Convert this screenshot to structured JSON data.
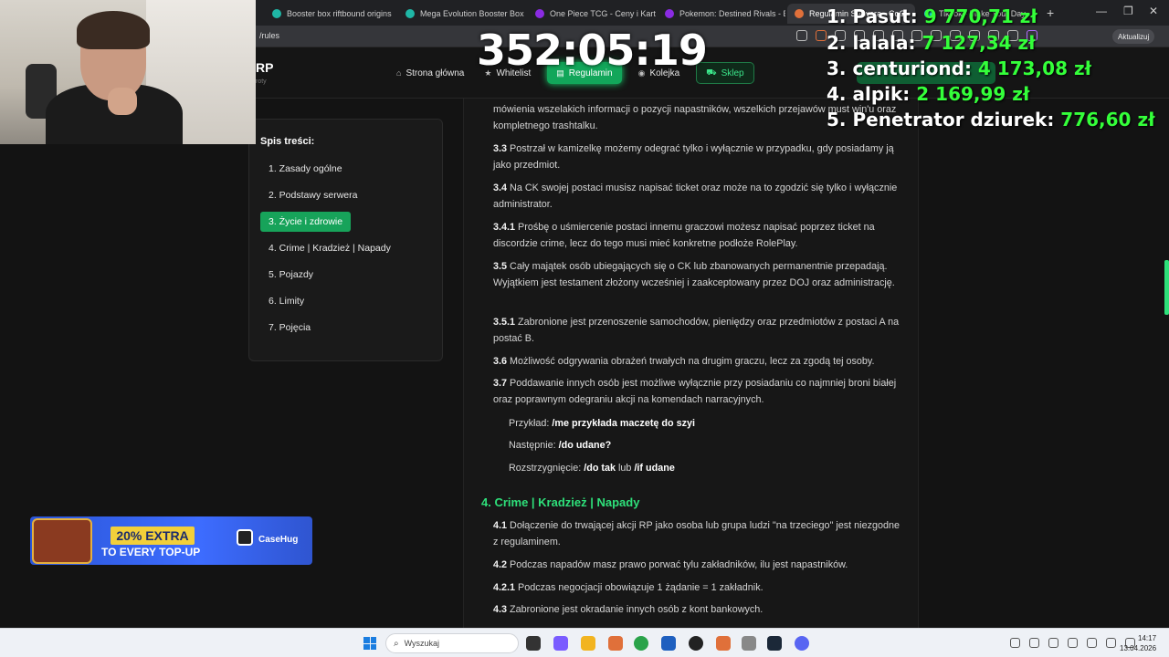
{
  "browser": {
    "tabs": [
      {
        "label": "Booster box riftbound origins",
        "color": "#1fb7a6"
      },
      {
        "label": "Mega Evolution Booster Box",
        "color": "#1fb7a6"
      },
      {
        "label": "One Piece TCG - Ceny i Karty |",
        "color": "#8a2be2"
      },
      {
        "label": "Pokemon: Destined Rivals - Bo",
        "color": "#8a2be2"
      },
      {
        "label": "Regulamin Serwera - CoC",
        "color": "#e0703a"
      },
      {
        "label": "TikTok - Make Your Day",
        "color": "#25f4ee"
      }
    ],
    "url": "/rules",
    "update_label": "Aktualizuj"
  },
  "site": {
    "logo": "RP",
    "logo_sub": "roty",
    "nav": [
      {
        "label": "Strona główna",
        "icon": "home-icon",
        "glyph": "⌂"
      },
      {
        "label": "Whitelist",
        "icon": "star-icon",
        "glyph": "★"
      },
      {
        "label": "Regulamin",
        "icon": "book-icon",
        "glyph": "▤"
      },
      {
        "label": "Kolejka",
        "icon": "user-icon",
        "glyph": "👤"
      },
      {
        "label": "Sklep",
        "icon": "cart-icon",
        "glyph": "🛒"
      }
    ]
  },
  "toc": {
    "title": "Spis treści:",
    "items": [
      "1. Zasady ogólne",
      "2. Podstawy serwera",
      "3. Życie i zdrowie",
      "4. Crime | Kradzież | Napady",
      "5. Pojazdy",
      "6. Limity",
      "7. Pojęcia"
    ],
    "active_index": 2
  },
  "rules": {
    "intro": "mówienia wszelakich informacji o pozycji napastników, wszelkich przejawów must win'u oraz kompletnego trashtalku.",
    "items": [
      {
        "num": "3.3",
        "text": "Postrzał w kamizelkę możemy odegrać tylko i wyłącznie w przypadku, gdy posiadamy ją jako przedmiot."
      },
      {
        "num": "3.4",
        "text": "Na CK swojej postaci musisz napisać ticket oraz może na to zgodzić się tylko i wyłącznie administrator."
      },
      {
        "num": "3.4.1",
        "text": "Prośbę o uśmiercenie postaci innemu graczowi możesz napisać poprzez ticket na discordzie crime, lecz do tego musi mieć konkretne podłoże RolePlay."
      },
      {
        "num": "3.5",
        "text": "Cały majątek osób ubiegających się o CK lub zbanowanych permanentnie przepadają. Wyjątkiem jest testament złożony wcześniej i zaakceptowany przez DOJ oraz administrację."
      },
      {
        "num": "3.5.1",
        "text": "Zabronione jest przenoszenie samochodów, pieniędzy oraz przedmiotów z postaci A na postać B."
      },
      {
        "num": "3.6",
        "text": "Możliwość odgrywania obrażeń trwałych na drugim graczu, lecz za zgodą tej osoby."
      },
      {
        "num": "3.7",
        "text": "Poddawanie innych osób jest możliwe wyłącznie przy posiadaniu co najmniej broni białej oraz poprawnym odegraniu akcji na komendach narracyjnych."
      }
    ],
    "example": {
      "l1_label": "Przykład:",
      "l1_cmd": "/me przykłada maczetę do szyi",
      "l2_label": "Następnie:",
      "l2_cmd": "/do udane?",
      "l3_label": "Rozstrzygnięcie:",
      "l3_cmd1": "/do tak",
      "l3_mid": "lub",
      "l3_cmd2": "/if udane"
    },
    "section4_title": "4. Crime | Kradzież | Napady",
    "section4": [
      {
        "num": "4.1",
        "text": "Dołączenie do trwającej akcji RP jako osoba lub grupa ludzi \"na trzeciego\" jest niezgodne z regulaminem."
      },
      {
        "num": "4.2",
        "text": "Podczas napadów masz prawo porwać tylu zakładników, ilu jest napastników."
      },
      {
        "num": "4.2.1",
        "text": "Podczas negocjacji obowiązuje 1 żądanie = 1 zakładnik."
      },
      {
        "num": "4.3",
        "text": "Zabronione jest okradanie innych osób z kont bankowych."
      }
    ]
  },
  "overlay": {
    "timer": "352:05:19",
    "leaderboard": [
      {
        "name": "1. Pasut:",
        "value": "9 770,71 zł"
      },
      {
        "name": "2. lalala:",
        "value": "7 127,34 zł"
      },
      {
        "name": "3. centuriond:",
        "value": "4 173,08 zł"
      },
      {
        "name": "4. alpik:",
        "value": "2 169,99 zł"
      },
      {
        "name": "5. Penetrator dziurek:",
        "value": "776,60 zł"
      }
    ],
    "banner": {
      "line1": "20% EXTRA",
      "line2": "TO EVERY TOP-UP",
      "brand": "CaseHug"
    }
  },
  "taskbar": {
    "search_placeholder": "Wyszukaj",
    "time": "14:17",
    "date": "13.04.2026"
  }
}
